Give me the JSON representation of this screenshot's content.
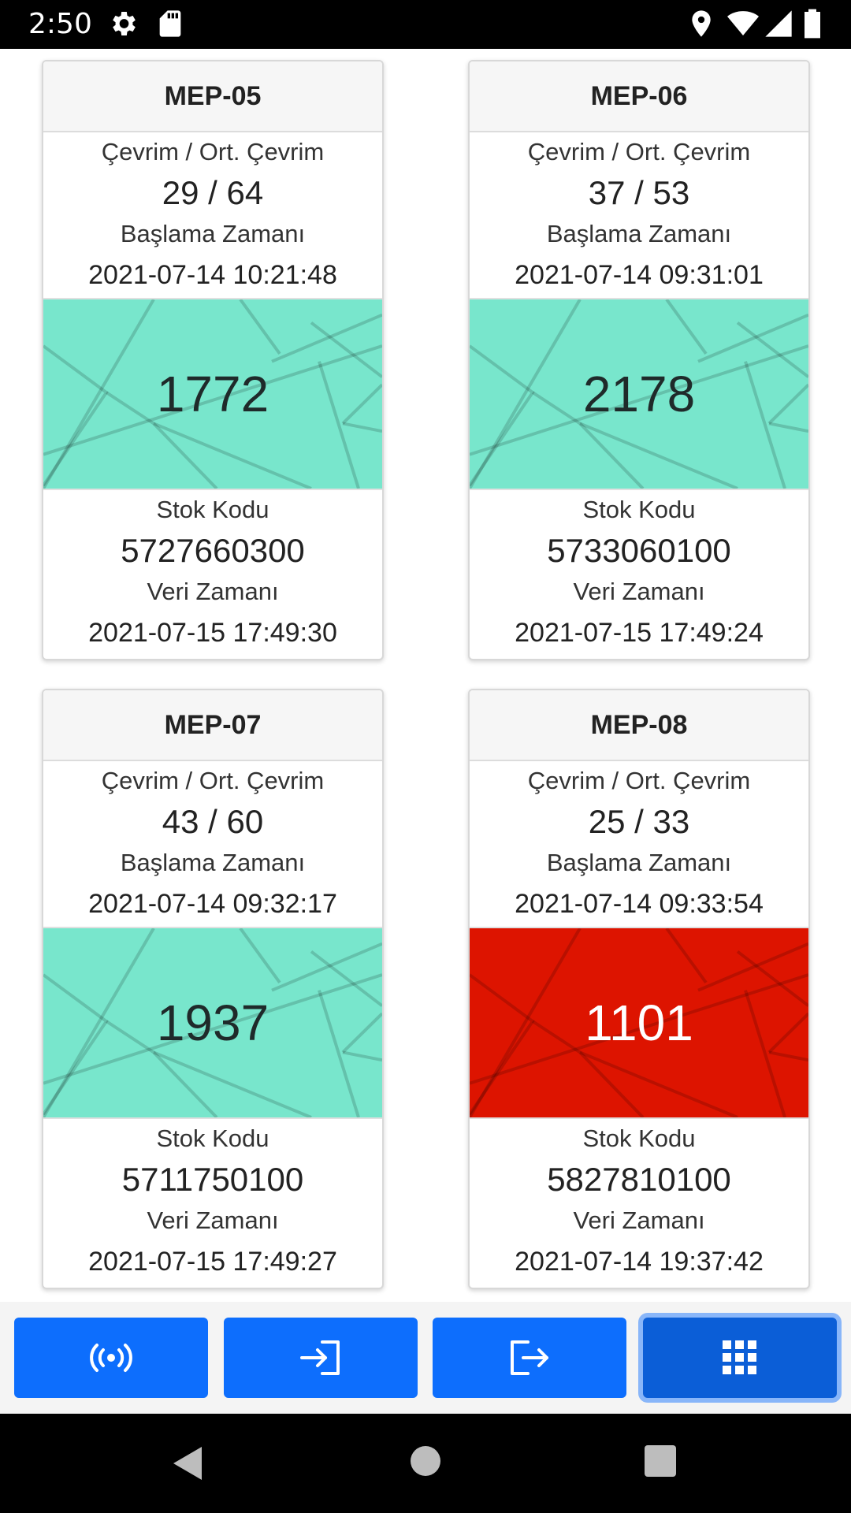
{
  "status_bar": {
    "time": "2:50",
    "icons": [
      "gear-icon",
      "sd-card-icon",
      "location-icon",
      "wifi-icon",
      "signal-icon",
      "battery-icon"
    ]
  },
  "machines": [
    {
      "title": "MEP-05",
      "cycle_label": "Çevrim / Ort. Çevrim",
      "cycle_value": "29 / 64",
      "start_label": "Başlama Zamanı",
      "start_time": "2021-07-14 10:21:48",
      "count": "1772",
      "status_color": "#78e6cc",
      "stock_label": "Stok Kodu",
      "stock_code": "5727660300",
      "data_label": "Veri Zamanı",
      "data_time": "2021-07-15 17:49:30"
    },
    {
      "title": "MEP-06",
      "cycle_label": "Çevrim / Ort. Çevrim",
      "cycle_value": "37 / 53",
      "start_label": "Başlama Zamanı",
      "start_time": "2021-07-14 09:31:01",
      "count": "2178",
      "status_color": "#78e6cc",
      "stock_label": "Stok Kodu",
      "stock_code": "5733060100",
      "data_label": "Veri Zamanı",
      "data_time": "2021-07-15 17:49:24"
    },
    {
      "title": "MEP-07",
      "cycle_label": "Çevrim / Ort. Çevrim",
      "cycle_value": "43 / 60",
      "start_label": "Başlama Zamanı",
      "start_time": "2021-07-14 09:32:17",
      "count": "1937",
      "status_color": "#78e6cc",
      "stock_label": "Stok Kodu",
      "stock_code": "5711750100",
      "data_label": "Veri Zamanı",
      "data_time": "2021-07-15 17:49:27"
    },
    {
      "title": "MEP-08",
      "cycle_label": "Çevrim / Ort. Çevrim",
      "cycle_value": "25 / 33",
      "start_label": "Başlama Zamanı",
      "start_time": "2021-07-14 09:33:54",
      "count": "1101",
      "status_color": "#dd1400",
      "stock_label": "Stok Kodu",
      "stock_code": "5827810100",
      "data_label": "Veri Zamanı",
      "data_time": "2021-07-14 19:37:42"
    }
  ],
  "toolbar": {
    "buttons": [
      {
        "icon": "broadcast-icon",
        "active": false
      },
      {
        "icon": "sign-in-icon",
        "active": false
      },
      {
        "icon": "sign-out-icon",
        "active": false
      },
      {
        "icon": "grid-icon",
        "active": true
      }
    ],
    "accent_color": "#0d6efd"
  },
  "nav_bar": {
    "icons": [
      "back-icon",
      "home-icon",
      "recents-icon"
    ]
  }
}
